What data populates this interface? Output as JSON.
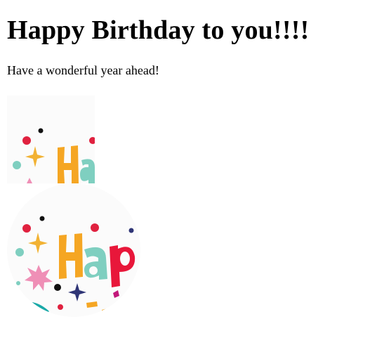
{
  "heading": "Happy Birthday to you!!!!",
  "message": "Have a wonderful year ahead!",
  "images": [
    {
      "name": "birthday-card-image-cropped",
      "shape": "square-crop"
    },
    {
      "name": "birthday-card-image-circle",
      "shape": "circle"
    }
  ],
  "colors": {
    "background": "#ffffff",
    "text": "#000000",
    "letter_yellow": "#f5a623",
    "letter_teal": "#7fcfc0",
    "letter_red": "#e8173a",
    "dot_red": "#e0213f",
    "dot_black": "#111111",
    "sparkle_yellow": "#f2b233",
    "sparkle_navy": "#2f3576",
    "star_pink": "#ef8fb6",
    "ribbon_teal": "#1aa9a8"
  }
}
